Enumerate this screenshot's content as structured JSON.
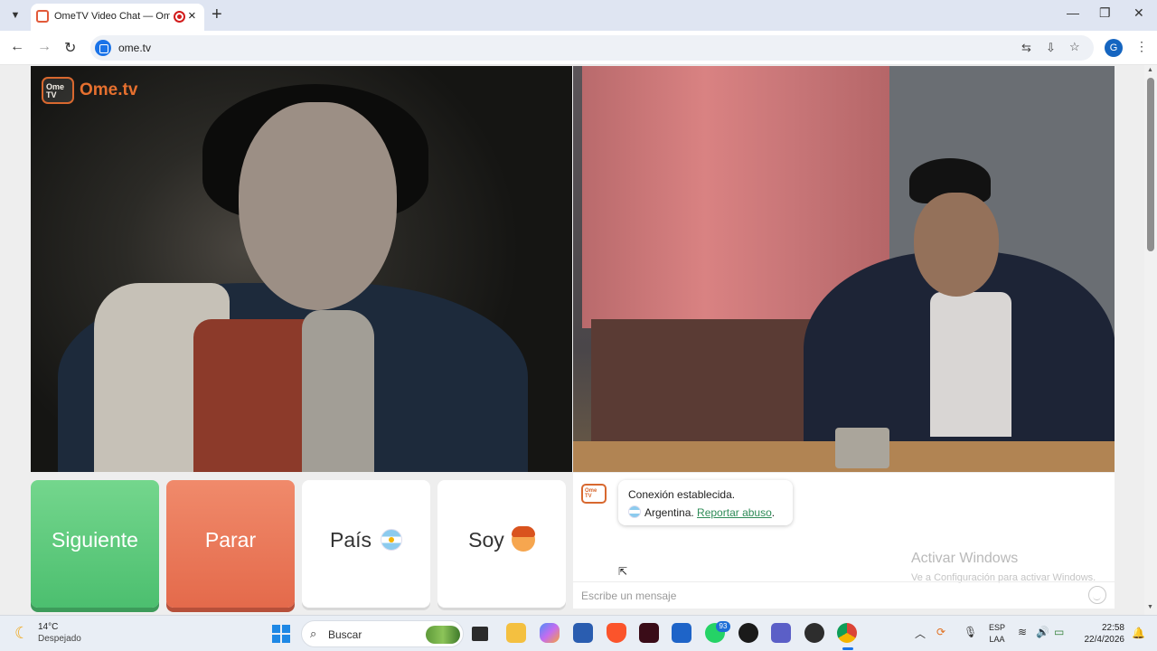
{
  "browser": {
    "tab_title": "OmeTV Video Chat — Omegle",
    "url": "ome.tv"
  },
  "logo": {
    "badge": "Ome TV",
    "wordmark": "Ome.tv"
  },
  "buttons": {
    "next": "Siguiente",
    "stop": "Parar",
    "country": "País",
    "gender": "Soy"
  },
  "chat": {
    "status": "Conexión establecida.",
    "country": "Argentina.",
    "report_link": "Reportar abuso",
    "report_period": ".",
    "input_placeholder": "Escribe un mensaje"
  },
  "watermark": {
    "title": "Activar Windows",
    "subtitle": "Ve a Configuración para activar Windows."
  },
  "taskbar": {
    "temperature": "14°C",
    "condition": "Despejado",
    "search_placeholder": "Buscar",
    "whatsapp_badge": "93",
    "lang_top": "ESP",
    "lang_bottom": "LAA",
    "time": "22:58",
    "date": "22/4/2026"
  },
  "colors": {
    "next_button": "#4cbf6f",
    "stop_button": "#e46a4b",
    "brand_orange": "#e6702f",
    "link_green": "#2e8b57"
  },
  "icons": [
    "tab-search-icon",
    "back-icon",
    "forward-icon",
    "reload-icon",
    "translate-icon",
    "install-icon",
    "star-icon",
    "menu-icon",
    "emoji-icon",
    "start-icon",
    "search-icon",
    "moon-icon",
    "wifi-icon",
    "volume-icon",
    "battery-icon",
    "bell-icon"
  ]
}
